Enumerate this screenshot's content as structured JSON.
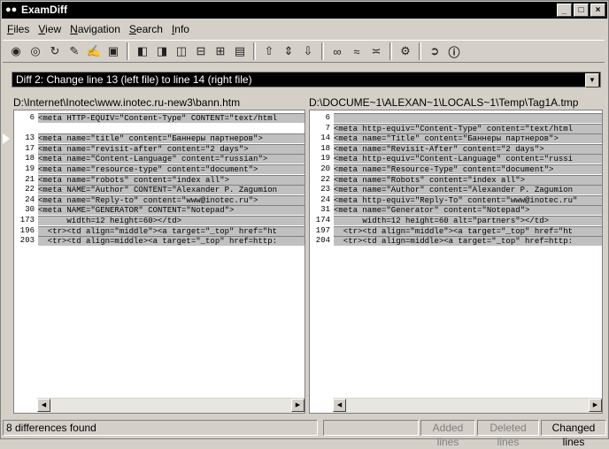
{
  "window": {
    "title": "ExamDiff"
  },
  "menu": [
    "Files",
    "View",
    "Navigation",
    "Search",
    "Info"
  ],
  "toolbar": {
    "icons": [
      "compare-icon",
      "binoculars-icon",
      "recompare-icon",
      "edit-icon",
      "edit-right-icon",
      "save-icon",
      "view-left-icon",
      "view-right-icon",
      "view-both-icon",
      "split-horizontal-icon",
      "split-vertical-icon",
      "window-list-icon",
      "prev-diff-icon",
      "first-diff-icon",
      "next-diff-icon",
      "find-icon",
      "find-next-icon",
      "find-prev-icon",
      "options-icon",
      "exit-icon",
      "info-icon"
    ]
  },
  "diff_selector": {
    "value": "Diff 2: Change line 13 (left file) to line 14 (right file)"
  },
  "left": {
    "path": "D:\\Internet\\Inotec\\www.inotec.ru-new3\\bann.htm",
    "lines": [
      {
        "n": "6",
        "text": "<meta HTTP-EQUIV=\"Content-Type\" CONTENT=\"text/html",
        "changed": true
      },
      {
        "n": "",
        "text": "",
        "changed": false
      },
      {
        "n": "13",
        "text": "<meta name=\"title\" content=\"Баннеры партнеров\">",
        "changed": true
      },
      {
        "n": "17",
        "text": "<meta name=\"revisit-after\" content=\"2 days\">",
        "changed": true
      },
      {
        "n": "18",
        "text": "<meta name=\"Content-Language\" content=\"russian\">",
        "changed": true
      },
      {
        "n": "19",
        "text": "<meta name=\"resource-type\" content=\"document\">",
        "changed": true
      },
      {
        "n": "21",
        "text": "<meta name=\"robots\" content=\"index all\">",
        "changed": true
      },
      {
        "n": "22",
        "text": "<meta NAME=\"Author\" CONTENT=\"Alexander P. Zagumion",
        "changed": true
      },
      {
        "n": "24",
        "text": "<meta name=\"Reply-to\" content=\"www@inotec.ru\">",
        "changed": true
      },
      {
        "n": "30",
        "text": "<meta NAME=\"GENERATOR\" CONTENT=\"Notepad\">",
        "changed": true
      },
      {
        "n": "173",
        "text": "      width=12 height=60></td>",
        "changed": true
      },
      {
        "n": "196",
        "text": "  <tr><td align=\"middle\"><a target=\"_top\" href=\"ht",
        "changed": true
      },
      {
        "n": "203",
        "text": "  <tr><td align=middle><a target=\"_top\" href=http:",
        "changed": true
      }
    ]
  },
  "right": {
    "path": "D:\\DOCUME~1\\ALEXAN~1\\LOCALS~1\\Temp\\Tag1A.tmp",
    "lines": [
      {
        "n": "6",
        "text": "",
        "changed": true
      },
      {
        "n": "7",
        "text": "<meta http-equiv=\"Content-Type\" content=\"text/html",
        "changed": true
      },
      {
        "n": "14",
        "text": "<meta name=\"Title\" content=\"Баннеры партнеров\">",
        "changed": true
      },
      {
        "n": "18",
        "text": "<meta name=\"Revisit-After\" content=\"2 days\">",
        "changed": true
      },
      {
        "n": "19",
        "text": "<meta http-equiv=\"Content-Language\" content=\"russi",
        "changed": true
      },
      {
        "n": "20",
        "text": "<meta name=\"Resource-Type\" content=\"document\">",
        "changed": true
      },
      {
        "n": "22",
        "text": "<meta name=\"Robots\" content=\"index all\">",
        "changed": true
      },
      {
        "n": "23",
        "text": "<meta name=\"Author\" content=\"Alexander P. Zagumion",
        "changed": true
      },
      {
        "n": "24",
        "text": "<meta http-equiv=\"Reply-To\" content=\"www@inotec.ru\"",
        "changed": true
      },
      {
        "n": "31",
        "text": "<meta name=\"Generator\" content=\"Notepad\">",
        "changed": true
      },
      {
        "n": "174",
        "text": "      width=12 height=60 alt=\"partners\"></td>",
        "changed": true
      },
      {
        "n": "197",
        "text": "  <tr><td align=\"middle\"><a target=\"_top\" href=\"ht",
        "changed": true
      },
      {
        "n": "204",
        "text": "  <tr><td align=middle><a target=\"_top\" href=http:",
        "changed": true
      }
    ]
  },
  "status": {
    "message": "8 differences found",
    "legend": [
      "Added lines",
      "Deleted lines",
      "Changed lines"
    ]
  }
}
